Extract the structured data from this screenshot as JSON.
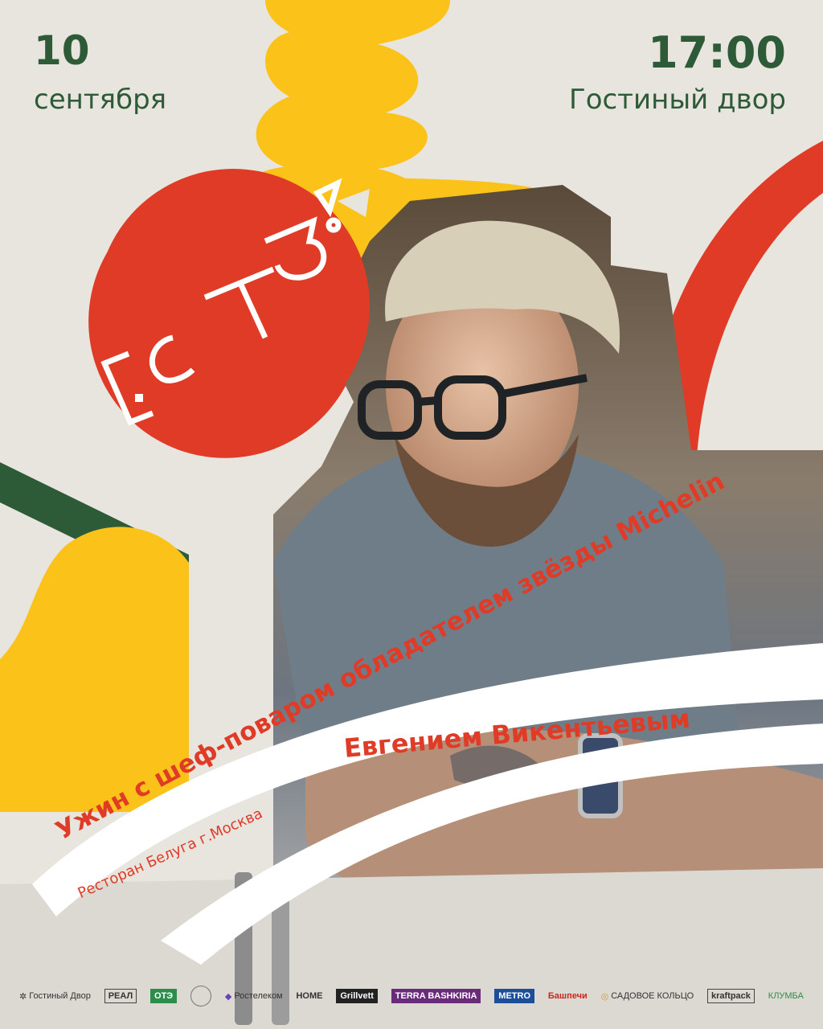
{
  "event": {
    "day": "10",
    "month": "сентября",
    "time": "17:00",
    "venue": "Гостиный двор"
  },
  "logo_text": "[ЕСТЬ!]",
  "ribbons": {
    "line1": "Ужин с шеф-поваром обладателем звёзды Michelin",
    "line2": "Евгением Викентьевым",
    "line3": "Ресторан Белуга г.Москва"
  },
  "sponsors": [
    {
      "name": "Гостиный Двор"
    },
    {
      "name": "РЕАЛ"
    },
    {
      "name": "ОТЭ"
    },
    {
      "name": "circle-emblem"
    },
    {
      "name": "Ростелеком"
    },
    {
      "name": "HOME"
    },
    {
      "name": "Grillvett"
    },
    {
      "name": "TERRA BASHKIRIA"
    },
    {
      "name": "METRO"
    },
    {
      "name": "Башпечи"
    },
    {
      "name": "САДОВОЕ КОЛЬЦО"
    },
    {
      "name": "kraftpack"
    },
    {
      "name": "КЛУМБА"
    }
  ],
  "colors": {
    "background": "#e8e4de",
    "yellow": "#fbc21a",
    "red": "#e03b26",
    "green": "#2d5a37",
    "white": "#ffffff"
  }
}
